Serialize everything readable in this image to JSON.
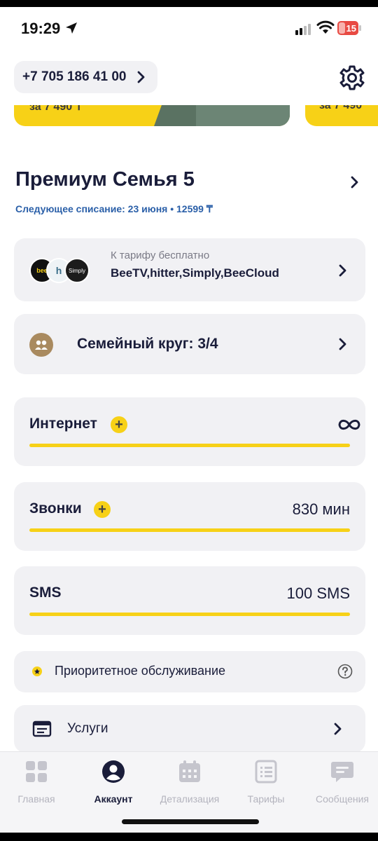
{
  "status_bar": {
    "time": "19:29",
    "battery": "15"
  },
  "header": {
    "phone": "+7 705 186 41 00"
  },
  "banners": {
    "left_partial_text": "за 7 490 ₸",
    "right_partial_text": "за 7 490"
  },
  "plan": {
    "name": "Премиум Семья 5",
    "next_charge": "Следующее списание: 23 июня  •  12599 ₸"
  },
  "free_services": {
    "label": "К тарифу бесплатно",
    "list": "BeeTV,hitter,Simply,BeeCloud",
    "logos": [
      "bee",
      "h",
      "Simply"
    ]
  },
  "family": {
    "label": "Семейный круг: 3/4"
  },
  "usage": {
    "internet": {
      "title": "Интернет",
      "value_icon": "infinity-icon",
      "fill": 1.0
    },
    "calls": {
      "title": "Звонки",
      "value": "830 мин",
      "fill": 1.0
    },
    "sms": {
      "title": "SMS",
      "value": "100 SMS",
      "fill": 1.0
    }
  },
  "priority": {
    "label": "Приоритетное обслуживание"
  },
  "services": {
    "label": "Услуги"
  },
  "tabs": [
    {
      "label": "Главная",
      "icon": "grid-icon",
      "active": false
    },
    {
      "label": "Аккаунт",
      "icon": "user-icon",
      "active": true
    },
    {
      "label": "Детализация",
      "icon": "calendar-icon",
      "active": false
    },
    {
      "label": "Тарифы",
      "icon": "list-icon",
      "active": false
    },
    {
      "label": "Сообщения",
      "icon": "chat-icon",
      "active": false
    }
  ],
  "colors": {
    "accent_yellow": "#f7d117",
    "text_dark": "#1a1d3a",
    "link_blue": "#2a5fa8",
    "card_bg": "#f1f1f4"
  }
}
